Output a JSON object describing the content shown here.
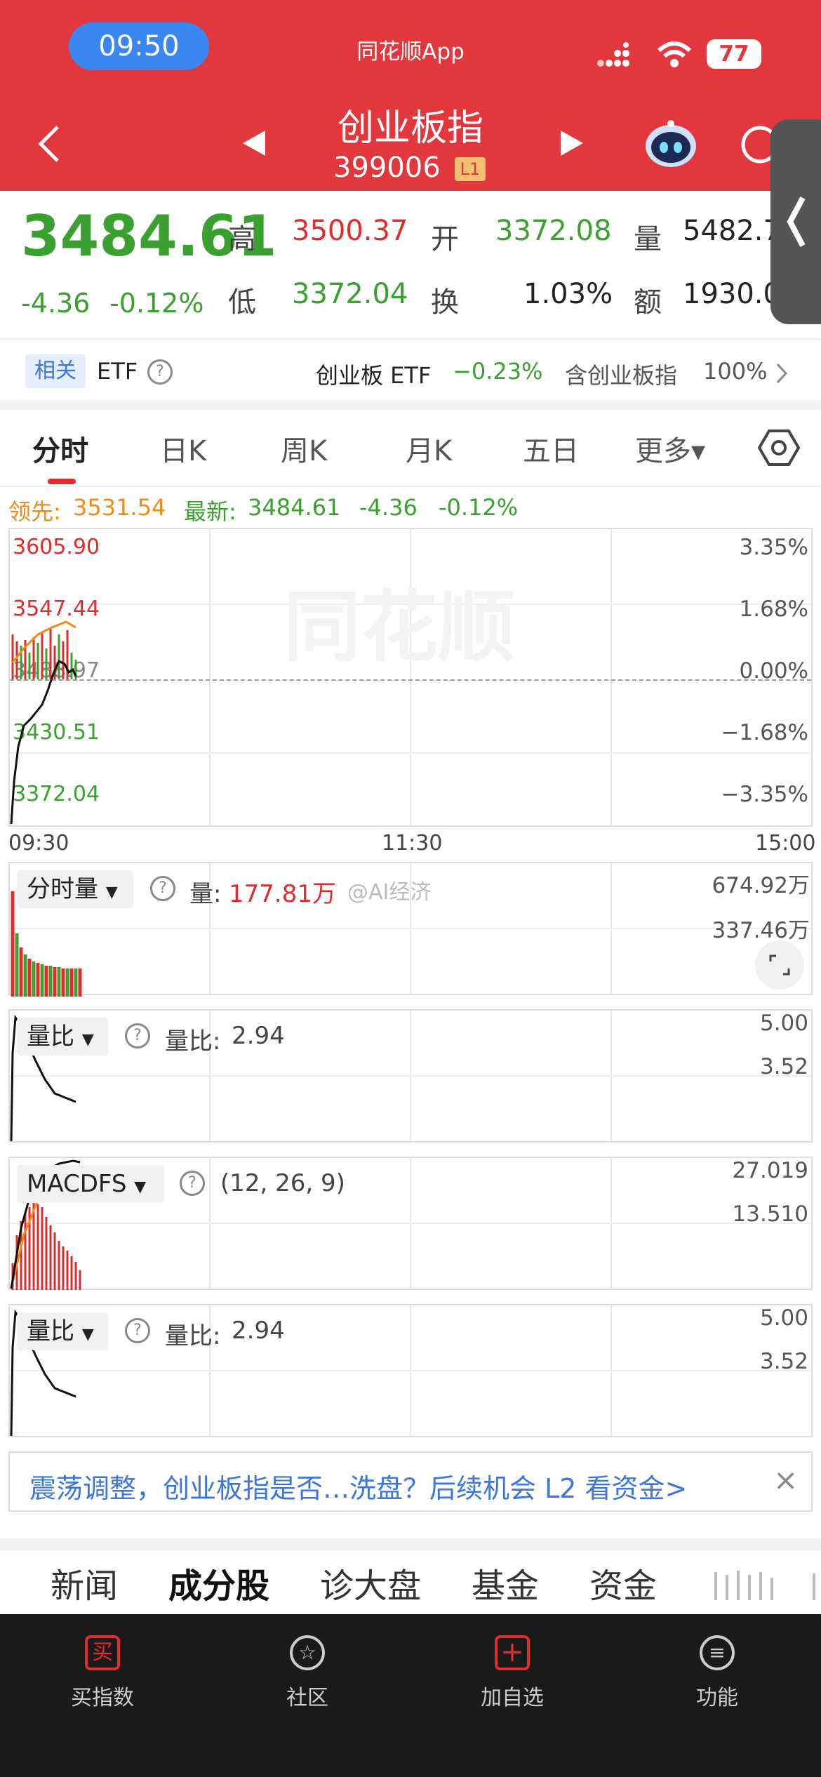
{
  "status_bar": {
    "time": "09:50",
    "app_name": "同花顺App",
    "battery": "77"
  },
  "header": {
    "title": "创业板指",
    "code": "399006",
    "level_badge": "L1",
    "back_icon": "chevron-left-icon",
    "prev_icon": "triangle-left-icon",
    "next_icon": "triangle-right-icon",
    "robot_icon": "robot-icon",
    "search_icon": "search-icon"
  },
  "quote": {
    "price": "3484.61",
    "change": "-4.36",
    "change_pct": "-0.12%",
    "high_label": "高",
    "high": "3500.37",
    "open_label": "开",
    "open": "3372.08",
    "volume_label": "量",
    "volume": "5482.7",
    "low_label": "低",
    "low": "3372.04",
    "turnover_label": "换",
    "turnover": "1.03%",
    "amount_label": "额",
    "amount": "1930.0"
  },
  "etf_row": {
    "related_badge": "相关",
    "etf_label": "ETF",
    "etf_name": "创业板 ETF",
    "etf_change": "−0.23%",
    "contains_label": "含创业板指",
    "contains_pct": "100%"
  },
  "tabs": [
    "分时",
    "日K",
    "周K",
    "月K",
    "五日",
    "更多▾"
  ],
  "active_tab": "分时",
  "legend": {
    "lead_label": "领先:",
    "lead_value": "3531.54",
    "latest_label": "最新:",
    "latest_value": "3484.61",
    "latest_change": "-4.36",
    "latest_pct": "-0.12%"
  },
  "main_chart": {
    "left_labels": [
      "3605.90",
      "3547.44",
      "3488.97",
      "3430.51",
      "3372.04"
    ],
    "right_labels": [
      "3.35%",
      "1.68%",
      "0.00%",
      "−1.68%",
      "−3.35%"
    ],
    "time_labels": [
      "09:30",
      "11:30",
      "15:00"
    ],
    "watermark": "同花顺"
  },
  "volume_panel": {
    "selector": "分时量",
    "label": "量:",
    "value": "177.81万",
    "scale_top": "674.92万",
    "scale_mid": "337.46万",
    "weibo_watermark": "@AI经济"
  },
  "ratio_panel_1": {
    "selector": "量比",
    "label": "量比:",
    "value": "2.94",
    "scale_top": "5.00",
    "scale_mid": "3.52"
  },
  "macd_panel": {
    "selector": "MACDFS",
    "params": "(12, 26, 9)",
    "scale_top": "27.019",
    "scale_mid": "13.510"
  },
  "ratio_panel_2": {
    "selector": "量比",
    "label": "量比:",
    "value": "2.94",
    "scale_top": "5.00",
    "scale_mid": "3.52"
  },
  "banner": {
    "text": "震荡调整，创业板指是否…洗盘？后续机会 L2 看资金>",
    "close": "×"
  },
  "bottom_tabs": [
    "新闻",
    "成分股",
    "诊大盘",
    "基金",
    "资金"
  ],
  "bottom_nav": [
    {
      "label": "买指数",
      "icon": "buy-icon"
    },
    {
      "label": "社区",
      "icon": "community-icon"
    },
    {
      "label": "加自选",
      "icon": "add-watchlist-icon"
    },
    {
      "label": "功能",
      "icon": "menu-icon"
    }
  ],
  "colors": {
    "header_red": "#e2373d",
    "up_red": "#e02c2c",
    "down_green": "#3aa02f",
    "lead_orange": "#f08a1a"
  }
}
